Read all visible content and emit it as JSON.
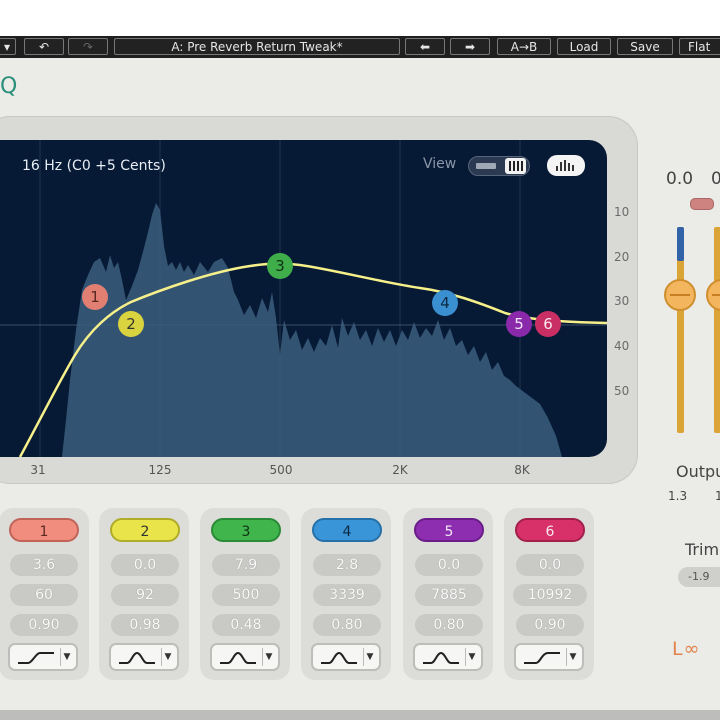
{
  "toolbar": {
    "preset_name": "A: Pre Reverb Return Tweak*",
    "prev_arrow": "⬅",
    "next_arrow": "➡",
    "compare": "A→B",
    "load": "Load",
    "save": "Save",
    "flat": "Flat"
  },
  "plugin": {
    "title_letter": "Q"
  },
  "display": {
    "freq_readout": "16 Hz (C0 +5 Cents)",
    "view_label": "View",
    "db_scale": [
      "10",
      "20",
      "30",
      "40",
      "50"
    ],
    "freq_scale": [
      "31",
      "125",
      "500",
      "2K",
      "8K"
    ]
  },
  "bands": [
    {
      "number": "1",
      "gain": "3.6",
      "freq": "60",
      "q": "0.90",
      "shape": "low-shelf-icon",
      "color": "#f08d7e"
    },
    {
      "number": "2",
      "gain": "0.0",
      "freq": "92",
      "q": "0.98",
      "shape": "bell-icon",
      "color": "#e9e44a"
    },
    {
      "number": "3",
      "gain": "7.9",
      "freq": "500",
      "q": "0.48",
      "shape": "bell-icon",
      "color": "#3fb54b"
    },
    {
      "number": "4",
      "gain": "2.8",
      "freq": "3339",
      "q": "0.80",
      "shape": "bell-icon",
      "color": "#3a95d8"
    },
    {
      "number": "5",
      "gain": "0.0",
      "freq": "7885",
      "q": "0.80",
      "shape": "bell-icon",
      "color": "#8d2eb0"
    },
    {
      "number": "6",
      "gain": "0.0",
      "freq": "10992",
      "q": "0.90",
      "shape": "high-shelf-icon",
      "color": "#d8316a"
    }
  ],
  "output": {
    "meter_value": "0.0",
    "meter_value_2": "0",
    "label": "Outpu",
    "value": "1.3",
    "value_2": "1"
  },
  "trim": {
    "label": "Trim",
    "value": "-1.9"
  },
  "brand": {
    "logo_text": "L∞"
  }
}
